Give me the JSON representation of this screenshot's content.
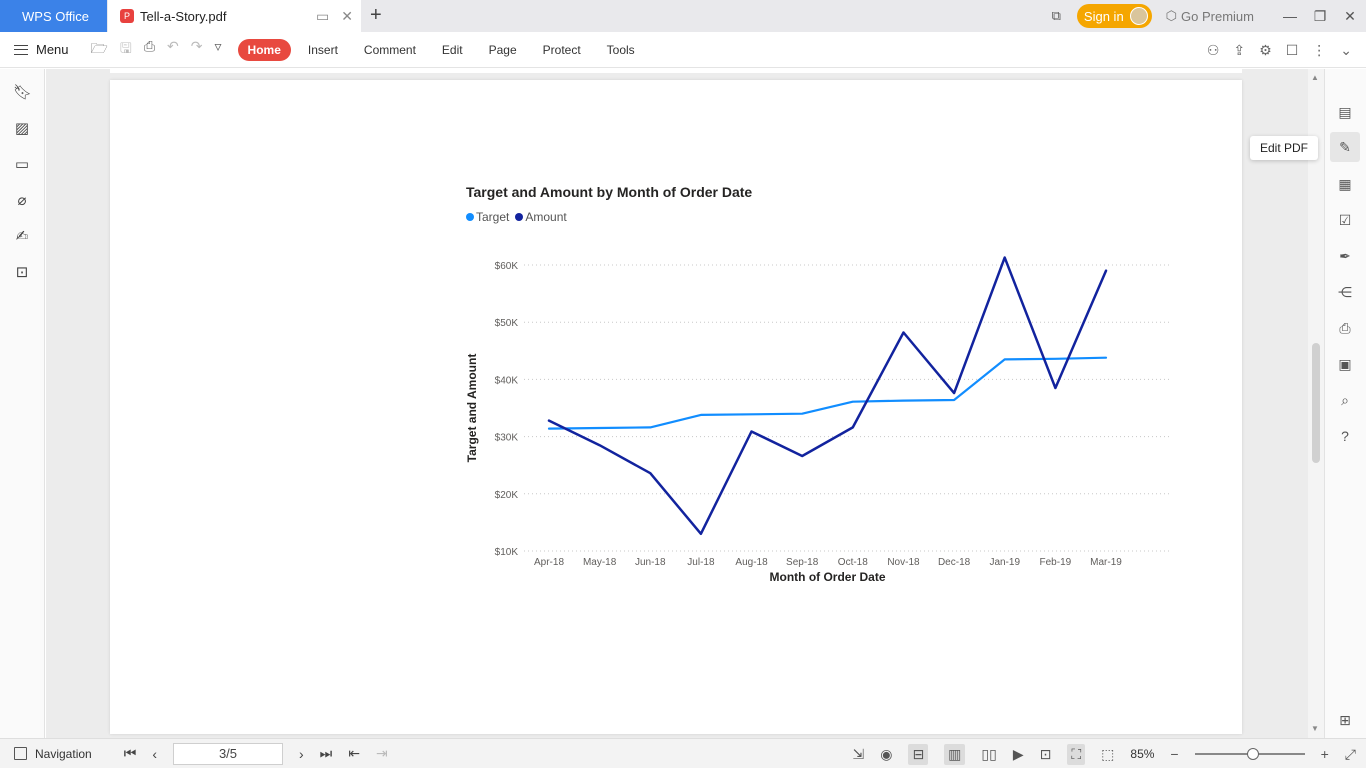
{
  "titlebar": {
    "app_tab": "WPS Office",
    "doc_tab": "Tell-a-Story.pdf",
    "signin": "Sign in",
    "premium": "Go Premium"
  },
  "toolbar": {
    "menu_label": "Menu",
    "tabs": [
      "Home",
      "Insert",
      "Comment",
      "Edit",
      "Page",
      "Protect",
      "Tools"
    ],
    "active_tab": "Home"
  },
  "tooltip": "Edit PDF",
  "statusbar": {
    "navigation": "Navigation",
    "page_value": "3/5",
    "zoom": "85%"
  },
  "colors": {
    "accent": "#3b82e8",
    "home_tab": "#e8493f",
    "signin": "#f5a600",
    "target": "#118dff",
    "amount": "#12239e"
  },
  "chart_data": {
    "type": "line",
    "title": "Target and Amount by Month of Order Date",
    "xlabel": "Month of Order Date",
    "ylabel": "Target and Amount",
    "categories": [
      "Apr-18",
      "May-18",
      "Jun-18",
      "Jul-18",
      "Aug-18",
      "Sep-18",
      "Oct-18",
      "Nov-18",
      "Dec-18",
      "Jan-19",
      "Feb-19",
      "Mar-19"
    ],
    "y_ticks": [
      "$10K",
      "$20K",
      "$30K",
      "$40K",
      "$50K",
      "$60K"
    ],
    "ylim": [
      10000,
      60000
    ],
    "legend_position": "top-left",
    "grid": "horizontal dotted",
    "series": [
      {
        "name": "Target",
        "color": "#118dff",
        "values": [
          31400,
          31500,
          31600,
          33800,
          33900,
          34000,
          36100,
          36300,
          36400,
          43500,
          43600,
          43800
        ]
      },
      {
        "name": "Amount",
        "color": "#12239e",
        "values": [
          32800,
          28500,
          23600,
          13000,
          30900,
          26600,
          31600,
          48200,
          37600,
          61300,
          38500,
          59000
        ]
      }
    ]
  }
}
